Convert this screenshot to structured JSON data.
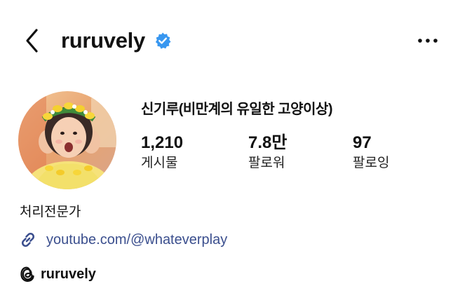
{
  "header": {
    "username": "ruruvely",
    "back_icon": "chevron-left-icon",
    "verified_icon": "verified-badge-icon",
    "more_icon": "more-horizontal-icon",
    "verified_color": "#3897f0"
  },
  "profile": {
    "full_name": "신기루(비만계의 유일한 고양이상)",
    "stats": [
      {
        "value": "1,210",
        "label": "게시물"
      },
      {
        "value": "7.8만",
        "label": "팔로워"
      },
      {
        "value": "97",
        "label": "팔로잉"
      }
    ],
    "bio": "처리전문가",
    "link": {
      "icon": "link-icon",
      "text": "youtube.com/@whateverplay",
      "color": "#3b4f8e"
    },
    "threads": {
      "icon": "threads-icon",
      "handle": "ruruvely"
    }
  }
}
